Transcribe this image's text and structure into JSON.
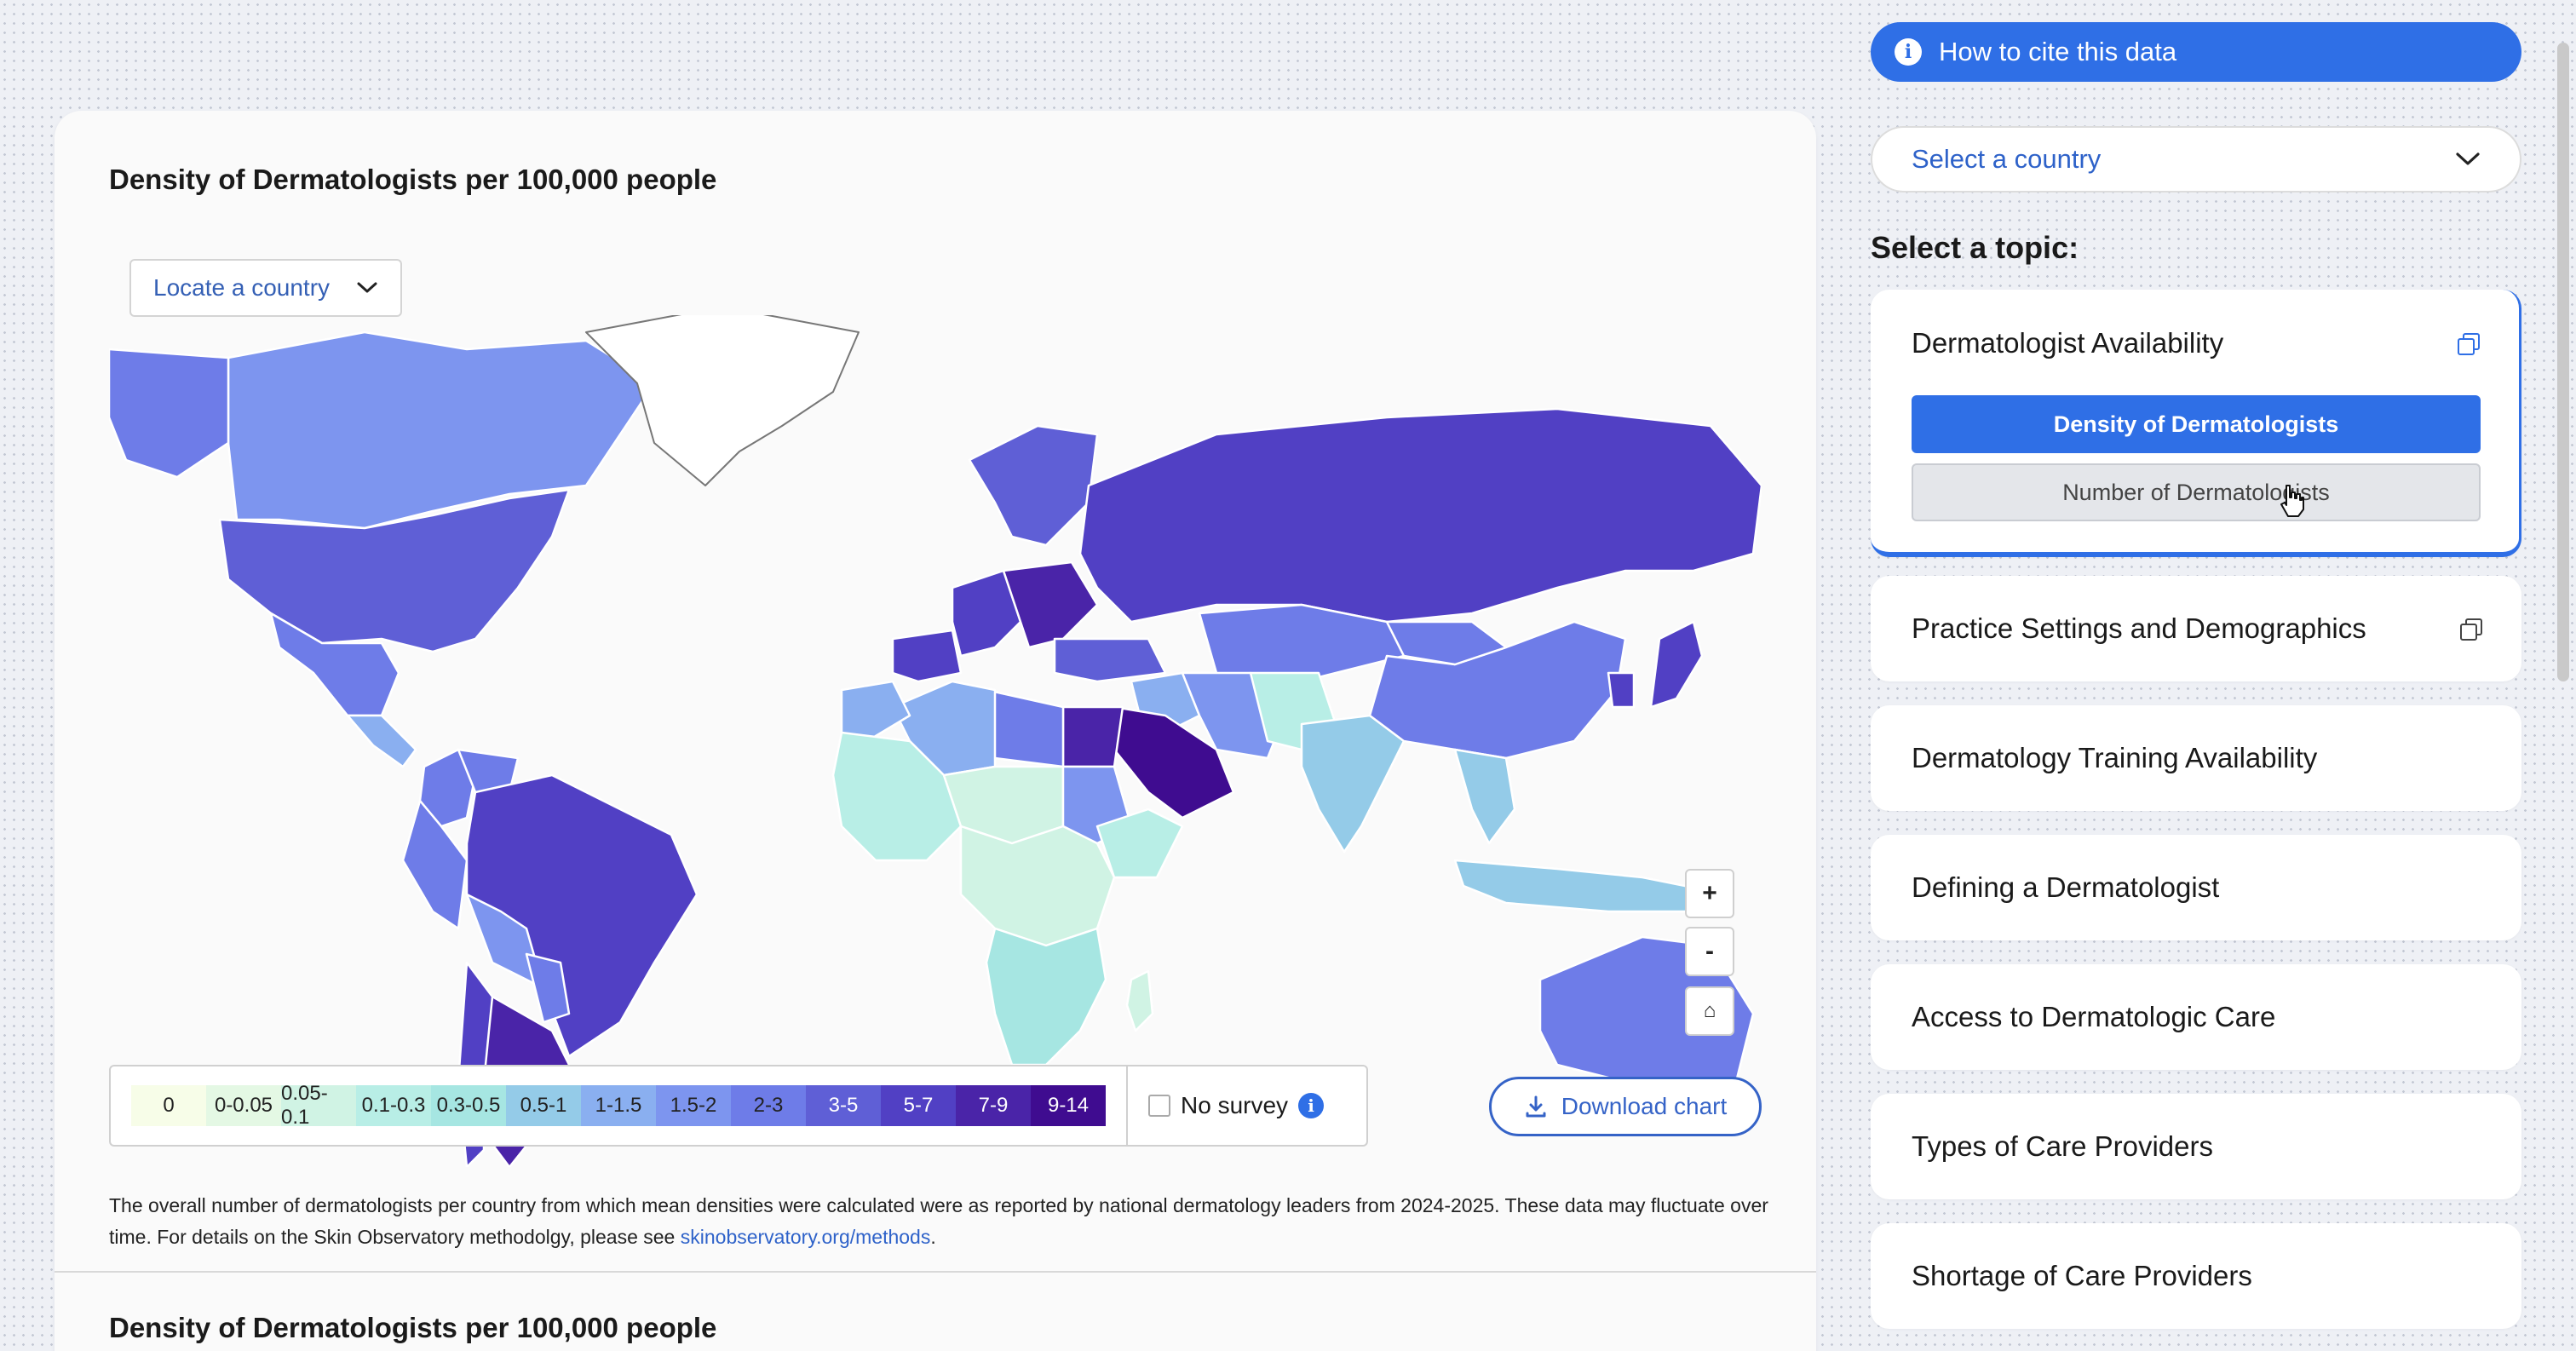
{
  "cite_button": "How to cite this data",
  "country_select": "Select a country",
  "topic_heading": "Select a topic:",
  "topics": [
    "Dermatologist Availability",
    "Practice Settings and Demographics",
    "Dermatology Training Availability",
    "Defining a Dermatologist",
    "Access to Dermatologic Care",
    "Types of Care Providers",
    "Shortage of Care Providers"
  ],
  "subtopics": {
    "active": "Density of Dermatologists",
    "other": "Number of Dermatologists"
  },
  "card": {
    "title": "Density of Dermatologists per 100,000 people",
    "title_repeat": "Density of Dermatologists per 100,000 people",
    "locate": "Locate a country",
    "download": "Download chart",
    "footnote_text": "The overall number of dermatologists per country from which mean densities were calculated were as reported by national dermatology leaders from 2024-2025. These data may fluctuate over time. For details on the Skin Observatory methodolgy, please see ",
    "footnote_link": "skinobservatory.org/methods",
    "footnote_end": "."
  },
  "zoom": {
    "plus": "+",
    "minus": "-",
    "home": "⌂"
  },
  "legend": {
    "no_survey": "No survey",
    "bins": [
      {
        "label": "0",
        "color": "#f7fde8"
      },
      {
        "label": "0-0.05",
        "color": "#e4f8e4"
      },
      {
        "label": "0.05-0.1",
        "color": "#d0f3e4"
      },
      {
        "label": "0.1-0.3",
        "color": "#b8eee6"
      },
      {
        "label": "0.3-0.5",
        "color": "#a6e6e2"
      },
      {
        "label": "0.5-1",
        "color": "#94cbe8"
      },
      {
        "label": "1-1.5",
        "color": "#8aaff0"
      },
      {
        "label": "1.5-2",
        "color": "#7d95ef"
      },
      {
        "label": "2-3",
        "color": "#6e7ce8"
      },
      {
        "label": "3-5",
        "color": "#5f5fd6"
      },
      {
        "label": "5-7",
        "color": "#5140c4"
      },
      {
        "label": "7-9",
        "color": "#4a24a8"
      },
      {
        "label": "9-14",
        "color": "#3f0c90"
      }
    ]
  },
  "map_regions": [
    {
      "name": "Canada",
      "color": "#7d95ef"
    },
    {
      "name": "Alaska",
      "color": "#6e7ce8"
    },
    {
      "name": "Greenland",
      "color": "#ffffff"
    },
    {
      "name": "United States",
      "color": "#5f5fd6"
    },
    {
      "name": "Mexico",
      "color": "#6e7ce8"
    },
    {
      "name": "Central America",
      "color": "#8aaff0"
    },
    {
      "name": "Colombia",
      "color": "#6e7ce8"
    },
    {
      "name": "Venezuela",
      "color": "#6e7ce8"
    },
    {
      "name": "Peru",
      "color": "#6e7ce8"
    },
    {
      "name": "Brazil",
      "color": "#5140c4"
    },
    {
      "name": "Bolivia",
      "color": "#7d95ef"
    },
    {
      "name": "Paraguay",
      "color": "#6e7ce8"
    },
    {
      "name": "Argentina",
      "color": "#4a24a8"
    },
    {
      "name": "Chile",
      "color": "#5140c4"
    },
    {
      "name": "Western Europe",
      "color": "#5140c4"
    },
    {
      "name": "Central Europe",
      "color": "#4a24a8"
    },
    {
      "name": "Scandinavia",
      "color": "#5f5fd6"
    },
    {
      "name": "Iberia",
      "color": "#5140c4"
    },
    {
      "name": "Russia",
      "color": "#5140c4"
    },
    {
      "name": "Kazakhstan",
      "color": "#6e7ce8"
    },
    {
      "name": "Turkey",
      "color": "#5f5fd6"
    },
    {
      "name": "Middle East",
      "color": "#8aaff0"
    },
    {
      "name": "Saudi Arabia",
      "color": "#3f0c90"
    },
    {
      "name": "Iran",
      "color": "#7d95ef"
    },
    {
      "name": "Egypt",
      "color": "#4a24a8"
    },
    {
      "name": "Libya",
      "color": "#6e7ce8"
    },
    {
      "name": "Algeria",
      "color": "#8aaff0"
    },
    {
      "name": "Morocco",
      "color": "#8aaff0"
    },
    {
      "name": "West Africa",
      "color": "#b8eee6"
    },
    {
      "name": "Sahel",
      "color": "#d0f3e4"
    },
    {
      "name": "Sudan",
      "color": "#7d95ef"
    },
    {
      "name": "Ethiopia",
      "color": "#b8eee6"
    },
    {
      "name": "Central Africa",
      "color": "#d0f3e4"
    },
    {
      "name": "Southern Africa",
      "color": "#a6e6e2"
    },
    {
      "name": "Pakistan",
      "color": "#b8eee6"
    },
    {
      "name": "India",
      "color": "#94cbe8"
    },
    {
      "name": "China",
      "color": "#6e7ce8"
    },
    {
      "name": "Mongolia",
      "color": "#6e7ce8"
    },
    {
      "name": "Japan",
      "color": "#5140c4"
    },
    {
      "name": "Korea",
      "color": "#5140c4"
    },
    {
      "name": "Southeast Asia",
      "color": "#94cbe8"
    },
    {
      "name": "Indonesia",
      "color": "#94cbe8"
    },
    {
      "name": "Australia",
      "color": "#6e7ce8"
    },
    {
      "name": "Madagascar",
      "color": "#d0f3e4"
    }
  ]
}
